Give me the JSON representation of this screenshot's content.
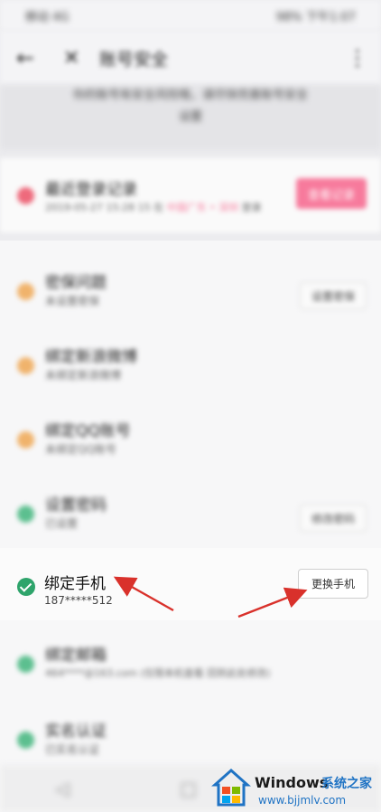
{
  "status": {
    "left": "移动 4G",
    "right": "98% 下午1:07"
  },
  "nav": {
    "back_icon": "←",
    "close_icon": "✕",
    "title": "账号安全",
    "more_icon": "⋮"
  },
  "tip": {
    "line1": "你的账号有安全风险哦，请尽快完善账号安全",
    "line2": "设置"
  },
  "login_record": {
    "title": "最近登录记录",
    "date": "2019-05-27 15:28 15 在",
    "highlight": "中国广东 • 深圳",
    "suffix": "登录",
    "button": "查看记录"
  },
  "items": [
    {
      "title": "密保问题",
      "sub": "未设置密保",
      "button": "设置密保",
      "color": "#f0b36c"
    },
    {
      "title": "绑定新浪微博",
      "sub": "未绑定新浪微博",
      "button": "",
      "color": "#f0b36c"
    },
    {
      "title": "绑定QQ账号",
      "sub": "未绑定QQ账号",
      "button": "",
      "color": "#f0b36c"
    },
    {
      "title": "设置密码",
      "sub": "已设置",
      "button": "修改密码",
      "color": "#5cbf8f"
    }
  ],
  "phone": {
    "title": "绑定手机",
    "number": "187*****512",
    "button": "更换手机"
  },
  "items_after": [
    {
      "title": "绑定邮箱",
      "sub": "464****@163.com (仅限本机查看 回到此处修改)",
      "color": "#5cbf8f"
    },
    {
      "title": "实名认证",
      "sub": "已实名认证",
      "color": "#5cbf8f"
    }
  ],
  "bottomnav": {
    "back": "◁",
    "home": "□"
  },
  "watermark": {
    "brand": "Windows",
    "cn": "系统之家",
    "url": "www.bjjmlv.com"
  },
  "colors": {
    "accent_pink": "#f77a9c",
    "green": "#2ea46b",
    "orange": "#f0b36c",
    "arrow_red": "#d9312b",
    "watermark_blue": "#1f73c4"
  }
}
